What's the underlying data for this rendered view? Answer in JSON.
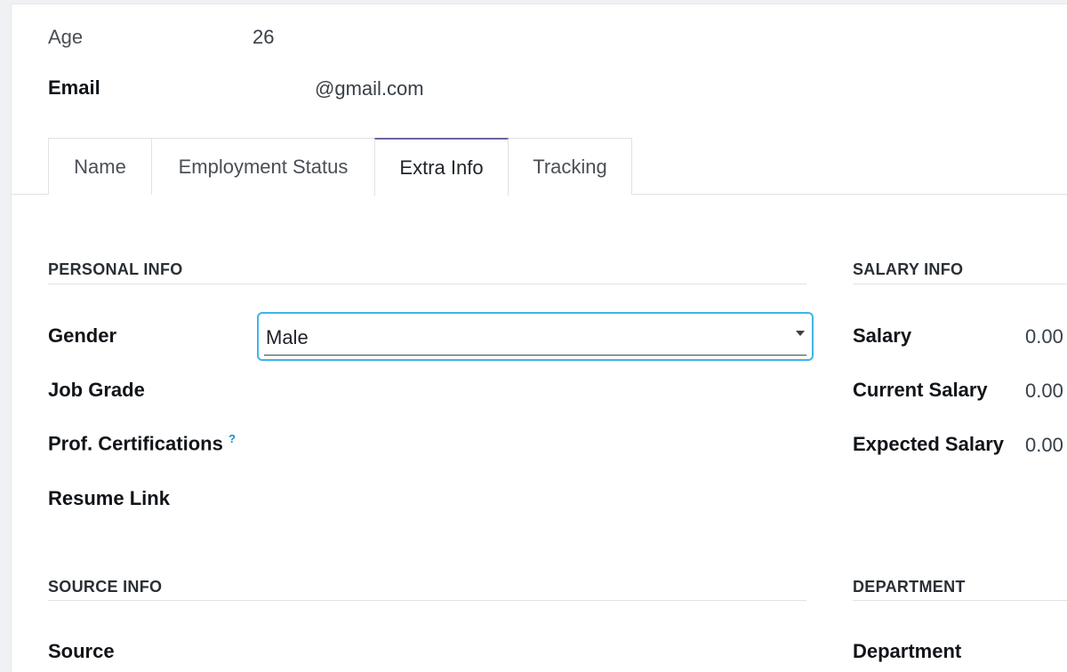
{
  "header": {
    "age_label": "Age",
    "age_value": "26",
    "email_label": "Email",
    "email_value": "@gmail.com"
  },
  "tabs": [
    {
      "label": "Name"
    },
    {
      "label": "Employment Status"
    },
    {
      "label": "Extra Info"
    },
    {
      "label": "Tracking"
    }
  ],
  "active_tab": "Extra Info",
  "personal_info": {
    "title": "PERSONAL INFO",
    "gender_label": "Gender",
    "gender_value": "Male",
    "job_grade_label": "Job Grade",
    "certifications_label": "Prof. Certifications",
    "certifications_help": "?",
    "resume_label": "Resume Link"
  },
  "salary_info": {
    "title": "SALARY INFO",
    "salary_label": "Salary",
    "salary_value": "0.00",
    "current_label": "Current Salary",
    "current_value": "0.00",
    "expected_label": "Expected Salary",
    "expected_value": "0.00"
  },
  "source_info": {
    "title": "SOURCE INFO",
    "source_label": "Source"
  },
  "department": {
    "title": "DEPARTMENT",
    "department_label": "Department"
  },
  "colors": {
    "focus_border": "#3fb5e6",
    "active_tab_top": "#71639e",
    "help_icon": "#1b8bc2"
  }
}
